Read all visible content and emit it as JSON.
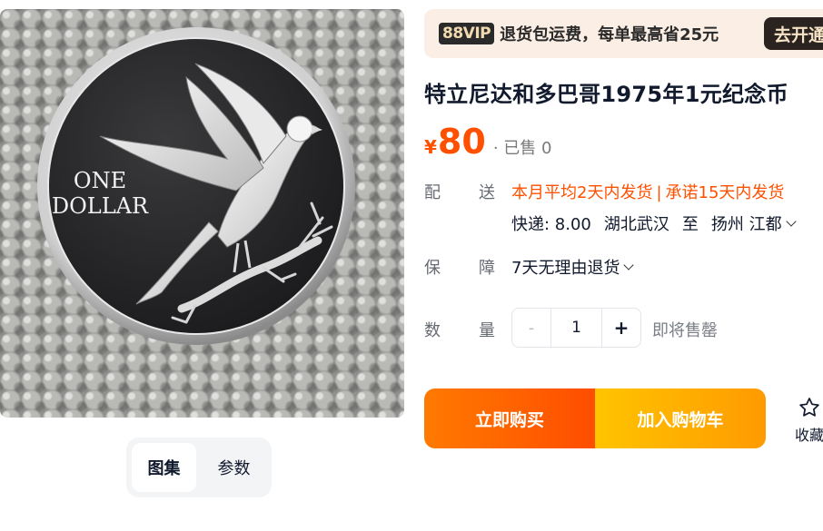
{
  "gallery": {
    "coin_inscription_line1": "ONE",
    "coin_inscription_line2": "DOLLAR",
    "tabs": [
      {
        "label": "图集",
        "active": true
      },
      {
        "label": "参数",
        "active": false
      }
    ]
  },
  "vip": {
    "badge": "88VIP",
    "text": "退货包运费，每单最高省25元",
    "button": "去开通"
  },
  "product": {
    "title": "特立尼达和多巴哥1975年1元纪念币",
    "price_symbol": "¥",
    "price": "80",
    "sold": "· 已售 0"
  },
  "delivery": {
    "label_a": "配",
    "label_b": "送",
    "promise1": "本月平均2天内发货",
    "separator": "|",
    "promise2": "承诺15天内发货",
    "fee": "快递: 8.00",
    "origin": "湖北武汉",
    "to": "至",
    "destination": "扬州 江都"
  },
  "guarantee": {
    "label_a": "保",
    "label_b": "障",
    "value": "7天无理由退货"
  },
  "quantity": {
    "label_a": "数",
    "label_b": "量",
    "minus": "-",
    "value": "1",
    "plus": "+",
    "note": "即将售罄"
  },
  "actions": {
    "buy_now": "立即购买",
    "add_cart": "加入购物车",
    "favorite": "收藏"
  },
  "colors": {
    "accent": "#ff5000",
    "buy_now": "#ff5a00",
    "add_cart": "#ffb300"
  }
}
